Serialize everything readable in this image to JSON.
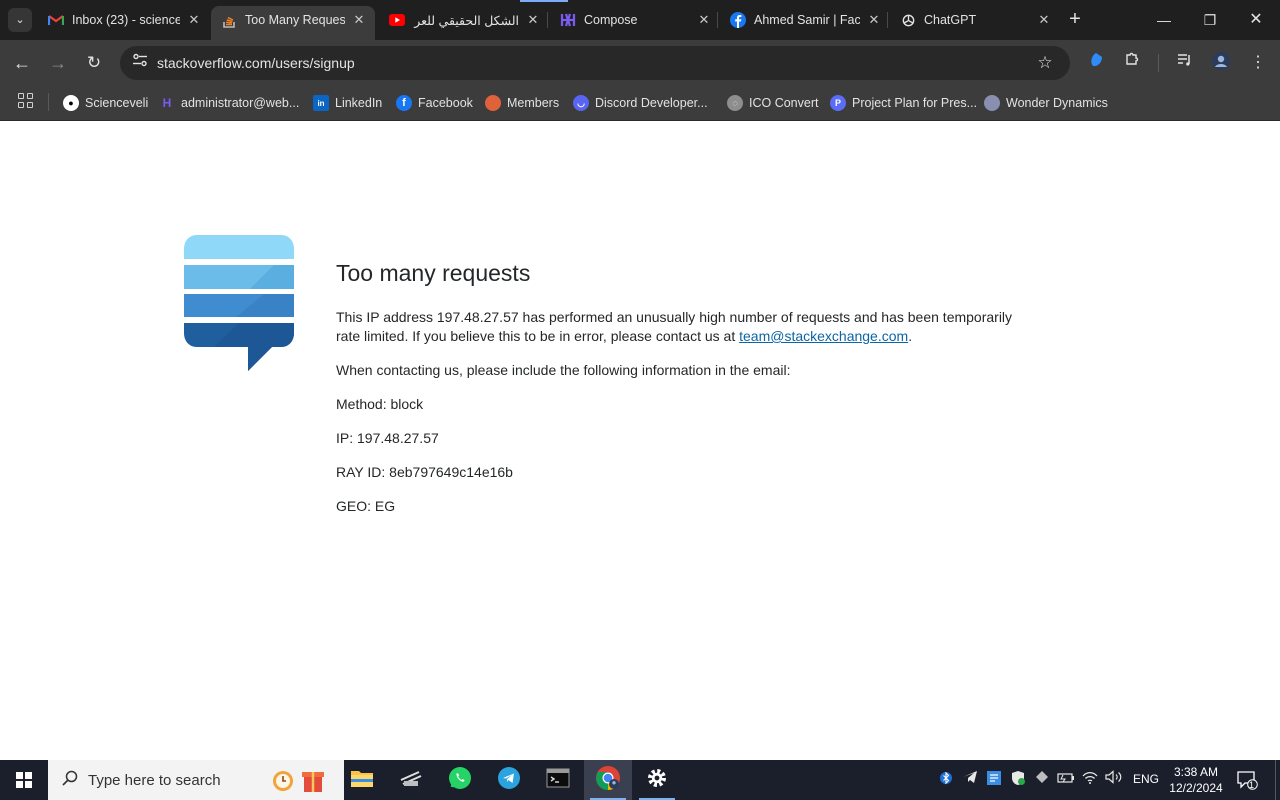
{
  "tabs": [
    {
      "label": "Inbox (23) - science",
      "icon": "gmail-icon"
    },
    {
      "label": "Too Many Requests",
      "icon": "stackoverflow-icon",
      "active": true
    },
    {
      "label": "الشكل الحقيقي للعر",
      "icon": "youtube-icon"
    },
    {
      "label": "Compose",
      "icon": "compose-app-icon"
    },
    {
      "label": "Ahmed Samir | Fac",
      "icon": "facebook-icon"
    },
    {
      "label": "ChatGPT",
      "icon": "chatgpt-icon"
    }
  ],
  "address_bar": {
    "url": "stackoverflow.com/users/signup"
  },
  "bookmarks": [
    {
      "label": "Scienceveli",
      "icon": "github-icon"
    },
    {
      "label": "administrator@web...",
      "icon": "webmail-icon"
    },
    {
      "label": "LinkedIn",
      "icon": "linkedin-icon"
    },
    {
      "label": "Facebook",
      "icon": "facebook-icon"
    },
    {
      "label": "Members",
      "icon": "members-icon"
    },
    {
      "label": "Discord Developer...",
      "icon": "discord-icon"
    },
    {
      "label": "ICO Convert",
      "icon": "globe-icon"
    },
    {
      "label": "Project Plan for Pres...",
      "icon": "project-plan-icon"
    },
    {
      "label": "Wonder Dynamics",
      "icon": "wonder-dynamics-icon"
    }
  ],
  "page": {
    "title": "Too many requests",
    "message_part1": "This IP address 197.48.27.57 has performed an unusually high number of requests and has been temporarily rate limited. If you believe this to be in error, please contact us at ",
    "contact_email": "team@stackexchange.com",
    "message_part2": ".",
    "instructions": "When contacting us, please include the following information in the email:",
    "details": [
      {
        "label": "Method:",
        "value": "block"
      },
      {
        "label": "IP:",
        "value": "197.48.27.57"
      },
      {
        "label": "RAY ID:",
        "value": "8eb797649c14e16b"
      },
      {
        "label": "GEO:",
        "value": "EG"
      }
    ]
  },
  "taskbar": {
    "search_placeholder": "Type here to search",
    "language": "ENG",
    "time": "3:38 AM",
    "date": "12/2/2024",
    "notification_count": "1"
  },
  "colors": {
    "chrome_dark": "#1f1f1f",
    "toolbar": "#3c3c3c",
    "link": "#0c65a5",
    "text": "#242729",
    "taskbar": "#1a1f2b"
  }
}
